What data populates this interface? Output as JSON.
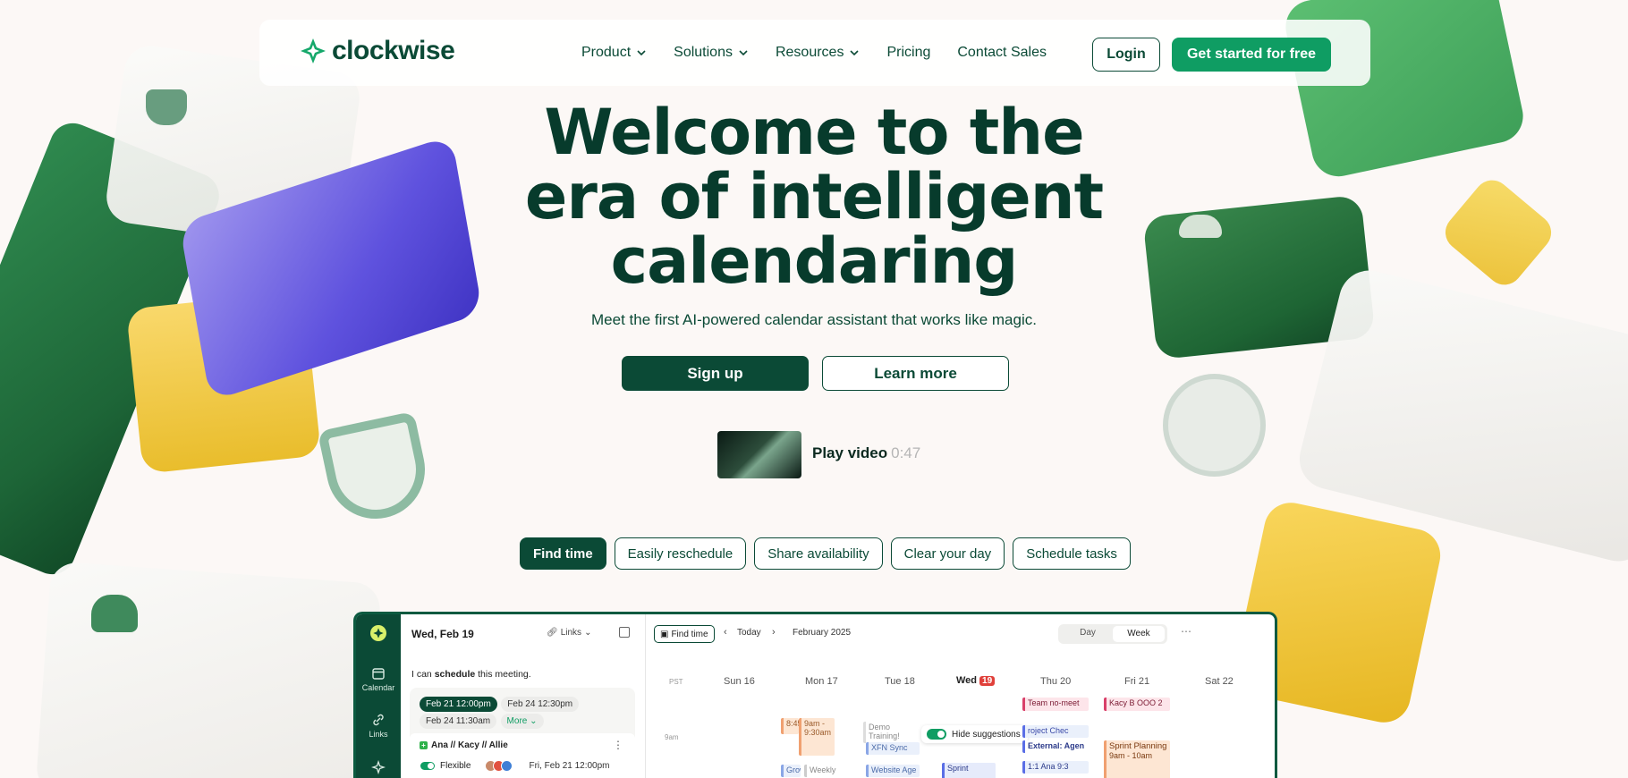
{
  "brand": {
    "name": "clockwise",
    "accent": "#0f9d63",
    "dark": "#0b4a36",
    "logo_icon": "sparkle-diamond-icon"
  },
  "nav": {
    "items": [
      {
        "label": "Product",
        "has_dropdown": true
      },
      {
        "label": "Solutions",
        "has_dropdown": true
      },
      {
        "label": "Resources",
        "has_dropdown": true
      },
      {
        "label": "Pricing",
        "has_dropdown": false
      },
      {
        "label": "Contact Sales",
        "has_dropdown": false
      }
    ],
    "login_label": "Login",
    "cta_label": "Get started for free"
  },
  "hero": {
    "headline_line1": "Welcome to the",
    "headline_line2": "era of intelligent",
    "headline_line3": "calendaring",
    "subtitle": "Meet the first AI-powered calendar assistant that works like magic.",
    "signup_label": "Sign up",
    "learn_more_label": "Learn more",
    "video_label": "Play video",
    "video_duration": "0:47"
  },
  "feature_tabs": [
    {
      "label": "Find time",
      "active": true
    },
    {
      "label": "Easily reschedule",
      "active": false
    },
    {
      "label": "Share availability",
      "active": false
    },
    {
      "label": "Clear your day",
      "active": false
    },
    {
      "label": "Schedule tasks",
      "active": false
    }
  ],
  "app": {
    "rail": [
      {
        "label": "Calendar"
      },
      {
        "label": "Links"
      }
    ],
    "left": {
      "date": "Wed, Feb 19",
      "links_label": "Links",
      "prompt_prefix": "I can ",
      "prompt_bold": "schedule",
      "prompt_suffix": " this meeting.",
      "slots": [
        "Feb 21 12:00pm",
        "Feb 24 12:30pm",
        "Feb 24 11:30am"
      ],
      "more_label": "More",
      "meeting_title": "Ana // Kacy // Allie",
      "flexible_label": "Flexible",
      "meeting_time": "Fri, Feb 21 12:00pm"
    },
    "right": {
      "find_time_label": "Find time",
      "today_label": "Today",
      "month": "February 2025",
      "view_day": "Day",
      "view_week": "Week",
      "timezone": "PST",
      "days": [
        {
          "label": "Sun 16"
        },
        {
          "label": "Mon 17"
        },
        {
          "label": "Tue 18"
        },
        {
          "label": "Wed",
          "badge": "19"
        },
        {
          "label": "Thu 20"
        },
        {
          "label": "Fri 21"
        },
        {
          "label": "Sat 22"
        }
      ],
      "hour_label": "9am",
      "hide_suggestions_label": "Hide suggestions",
      "events": {
        "team_no_meet": "Team no-meet",
        "kacy_ooo": "Kacy B OOO 2",
        "demo_training": "Demo Training!",
        "xfn_sync": "XFN Sync",
        "website_age": "Website Age",
        "project_check": "roject Chec",
        "external_agency": "External: Agen",
        "one_on_one": "1:1 Ana 9:3",
        "sprint_planning_thu": "Sprint",
        "sprint_planning_title": "Sprint Planning",
        "sprint_planning_time": "9am - 10am",
        "mon_time": "8:45",
        "mon_event": "9am - 9:30am",
        "mon_grow": "Grow",
        "mon_weekly": "Weekly"
      }
    }
  }
}
